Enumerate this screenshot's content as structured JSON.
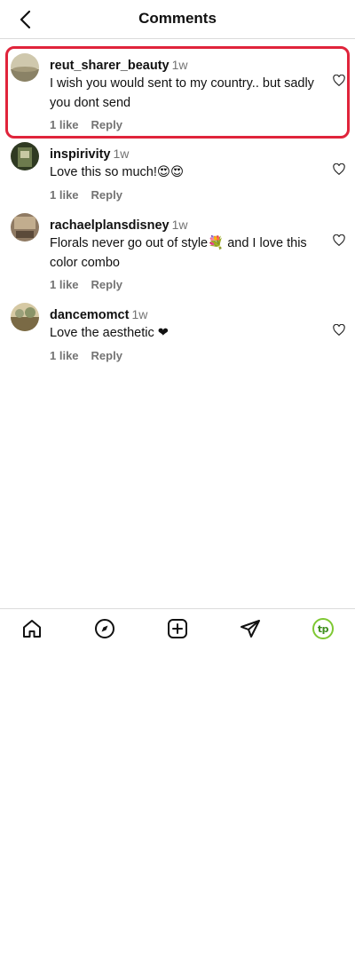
{
  "header": {
    "title": "Comments",
    "back_icon": "chevron-left-icon"
  },
  "comments": [
    {
      "username": "reut_sharer_beauty",
      "time": "1w",
      "text": "I wish you would sent to my country.. but sadly you dont send",
      "likes": "1 like",
      "reply": "Reply",
      "highlighted": true,
      "avatar_colors": [
        "#8a8266",
        "#c9c2a8"
      ]
    },
    {
      "username": "inspirivity",
      "time": "1w",
      "text": "Love this so much!😍😍",
      "likes": "1 like",
      "reply": "Reply",
      "avatar_colors": [
        "#3b4a2a",
        "#7b8a5a"
      ]
    },
    {
      "username": "rachaelplansdisney",
      "time": "1w",
      "text": "Florals never go out of style💐 and I love this color combo",
      "likes": "1 like",
      "reply": "Reply",
      "avatar_colors": [
        "#6b5a4a",
        "#b8a58a"
      ]
    },
    {
      "username": "dancemomct",
      "time": "1w",
      "text": "Love the aesthetic ❤",
      "likes": "1 like",
      "reply": "Reply",
      "avatar_colors": [
        "#7a6a45",
        "#d6c9a4"
      ]
    }
  ],
  "bottom_nav": {
    "items": [
      "home-icon",
      "explore-compass-icon",
      "new-post-plus-icon",
      "direct-message-send-icon",
      "profile-avatar"
    ],
    "profile_initials": "tp",
    "profile_color": "#7ec832"
  },
  "colors": {
    "highlight": "#e0243b",
    "muted": "#737373",
    "divider": "#dbdbdb"
  }
}
